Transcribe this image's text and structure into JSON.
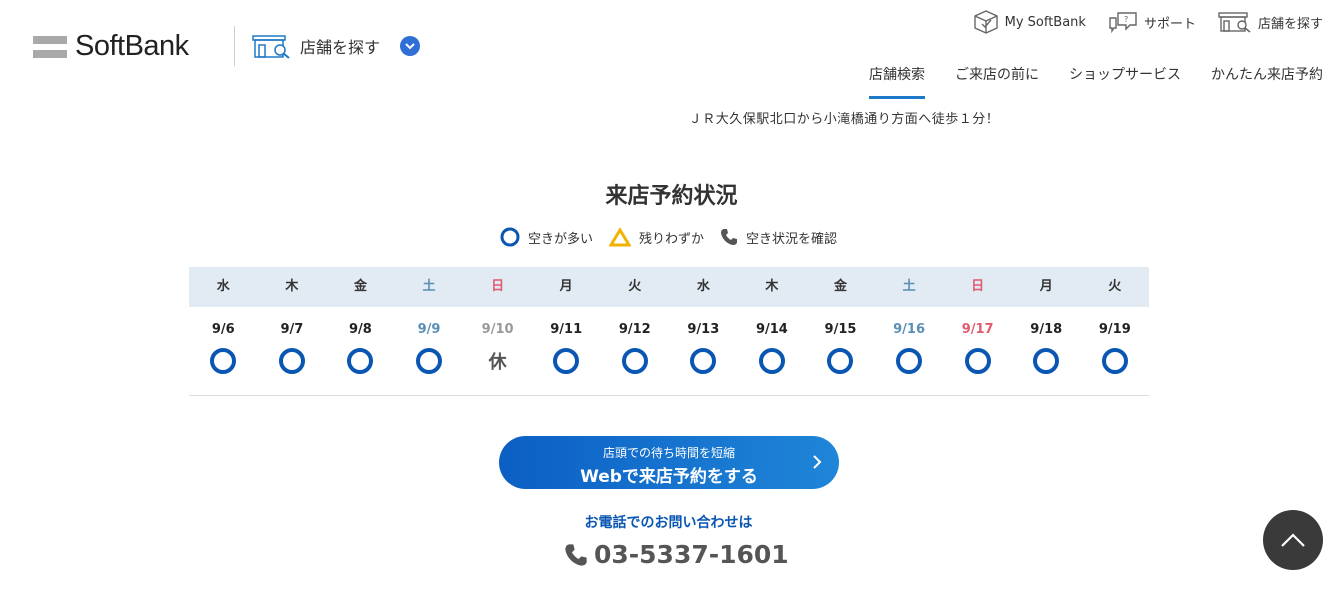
{
  "header": {
    "logo_text": "SoftBank",
    "store_search_label": "店舗を探す",
    "util_nav": [
      {
        "label": "My SoftBank",
        "icon": "mysoftbank-icon"
      },
      {
        "label": "サポート",
        "icon": "support-icon"
      },
      {
        "label": "店舗を探す",
        "icon": "store-icon"
      }
    ],
    "main_nav": [
      {
        "label": "店舗検索",
        "active": true
      },
      {
        "label": "ご来店の前に",
        "active": false
      },
      {
        "label": "ショップサービス",
        "active": false
      },
      {
        "label": "かんたん来店予約",
        "active": false
      }
    ]
  },
  "access_text": "ＪＲ大久保駅北口から小滝橋通り方面へ徒歩１分！",
  "reservation": {
    "title": "来店予約状況",
    "legend": [
      {
        "label": "空きが多い",
        "icon": "circle-icon"
      },
      {
        "label": "残りわずか",
        "icon": "triangle-icon"
      },
      {
        "label": "空き状況を確認",
        "icon": "phone-icon"
      }
    ],
    "days": [
      {
        "dow": "水",
        "date": "9/6",
        "status": "open",
        "type": "weekday"
      },
      {
        "dow": "木",
        "date": "9/7",
        "status": "open",
        "type": "weekday"
      },
      {
        "dow": "金",
        "date": "9/8",
        "status": "open",
        "type": "weekday"
      },
      {
        "dow": "土",
        "date": "9/9",
        "status": "open",
        "type": "sat"
      },
      {
        "dow": "日",
        "date": "9/10",
        "status": "closed",
        "type": "sun",
        "closed_label": "休"
      },
      {
        "dow": "月",
        "date": "9/11",
        "status": "open",
        "type": "weekday"
      },
      {
        "dow": "火",
        "date": "9/12",
        "status": "open",
        "type": "weekday"
      },
      {
        "dow": "水",
        "date": "9/13",
        "status": "open",
        "type": "weekday"
      },
      {
        "dow": "木",
        "date": "9/14",
        "status": "open",
        "type": "weekday"
      },
      {
        "dow": "金",
        "date": "9/15",
        "status": "open",
        "type": "weekday"
      },
      {
        "dow": "土",
        "date": "9/16",
        "status": "open",
        "type": "sat"
      },
      {
        "dow": "日",
        "date": "9/17",
        "status": "open",
        "type": "sun"
      },
      {
        "dow": "月",
        "date": "9/18",
        "status": "open",
        "type": "weekday"
      },
      {
        "dow": "火",
        "date": "9/19",
        "status": "open",
        "type": "weekday"
      }
    ],
    "colors": {
      "ring": "#0a56b3",
      "sat": "#5a8fb5",
      "sun": "#e25a6e",
      "header_bg": "#e2ebf3"
    }
  },
  "cta": {
    "sub": "店頭での待ち時間を短縮",
    "main": "Webで来店予約をする"
  },
  "phone": {
    "label": "お電話でのお問い合わせは",
    "number": "03-5337-1601"
  }
}
